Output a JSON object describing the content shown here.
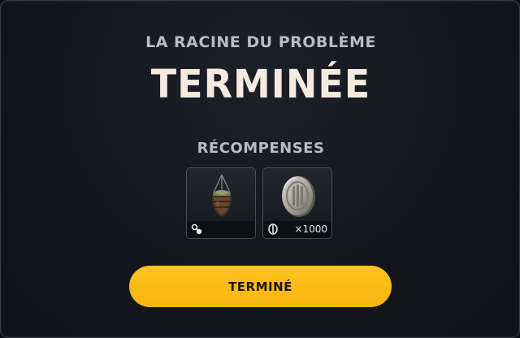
{
  "dialog": {
    "subtitle": "LA RACINE DU PROBLÈME",
    "title": "TERMINÉE",
    "rewards_heading": "RÉCOMPENSES",
    "rewards": [
      {
        "item_icon": "hanging-lantern-item",
        "badge_icon": "key-icon",
        "quantity": ""
      },
      {
        "item_icon": "silver-coin-item",
        "badge_icon": "coin-icon",
        "quantity": "×1000"
      }
    ],
    "done_label": "TERMINÉ"
  },
  "colors": {
    "accent_button": "#ffc21e",
    "title_text": "#f4ebe0",
    "muted_text": "#b9bcc4",
    "panel_background": "#15171e"
  }
}
